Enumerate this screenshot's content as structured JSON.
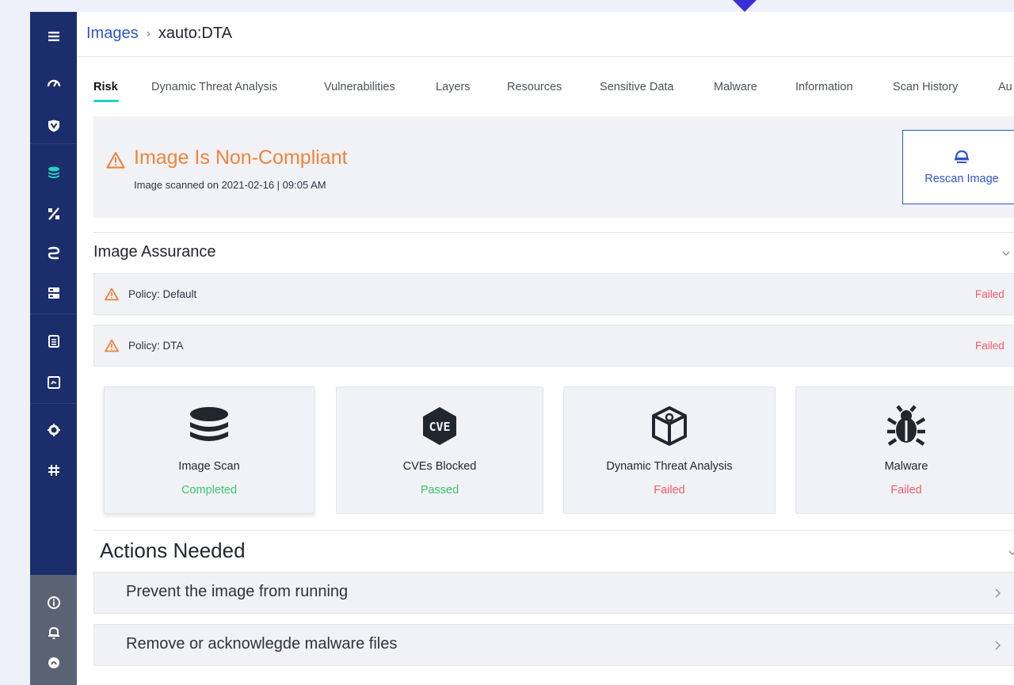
{
  "breadcrumb": {
    "root": "Images",
    "separator": "›",
    "current": "xauto:DTA"
  },
  "sidebar": {
    "items": [
      {
        "name": "menu-icon"
      },
      {
        "name": "dashboard-gauge-icon"
      },
      {
        "name": "shield-check-icon"
      },
      {
        "name": "layers-images-icon",
        "active": true
      },
      {
        "name": "percent-icon"
      },
      {
        "name": "functions-icon"
      },
      {
        "name": "server-icon"
      },
      {
        "name": "list-document-icon"
      },
      {
        "name": "report-icon"
      },
      {
        "name": "settings-gear-icon"
      },
      {
        "name": "integrations-grid-icon"
      },
      {
        "name": "info-icon"
      },
      {
        "name": "notifications-bell-icon"
      },
      {
        "name": "aqua-logo-icon"
      }
    ]
  },
  "tabs": [
    {
      "label": "Risk",
      "active": true
    },
    {
      "label": "Dynamic Threat Analysis"
    },
    {
      "label": "Vulnerabilities"
    },
    {
      "label": "Layers"
    },
    {
      "label": "Resources"
    },
    {
      "label": "Sensitive Data"
    },
    {
      "label": "Malware"
    },
    {
      "label": "Information"
    },
    {
      "label": "Scan History"
    },
    {
      "label": "Au"
    }
  ],
  "status": {
    "title": "Image Is Non-Compliant",
    "scanned": "Image scanned on 2021-02-16 | 09:05 AM",
    "color": "#f0833a"
  },
  "rescan_button": {
    "label": "Rescan Image"
  },
  "image_assurance": {
    "title": "Image Assurance",
    "policies": [
      {
        "label": "Policy: Default",
        "status": "Failed"
      },
      {
        "label": "Policy: DTA",
        "status": "Failed"
      }
    ]
  },
  "cards": [
    {
      "label": "Image Scan",
      "status": "Completed",
      "icon": "layers-stack-icon"
    },
    {
      "label": "CVEs Blocked",
      "status": "Passed",
      "icon": "cve-icon"
    },
    {
      "label": "Dynamic Threat Analysis",
      "status": "Failed",
      "icon": "dta-cube-icon"
    },
    {
      "label": "Malware",
      "status": "Failed",
      "icon": "bug-icon"
    }
  ],
  "actions": {
    "title": "Actions Needed",
    "items": [
      {
        "label": "Prevent the image from running"
      },
      {
        "label": "Remove or acknowlegde malware files"
      }
    ]
  },
  "colors": {
    "sidebar": "#1c2d6b",
    "accent": "#22d3c5",
    "link": "#3154c8",
    "warning": "#f0833a",
    "failed": "#f05a6a",
    "passed": "#38c46d"
  }
}
